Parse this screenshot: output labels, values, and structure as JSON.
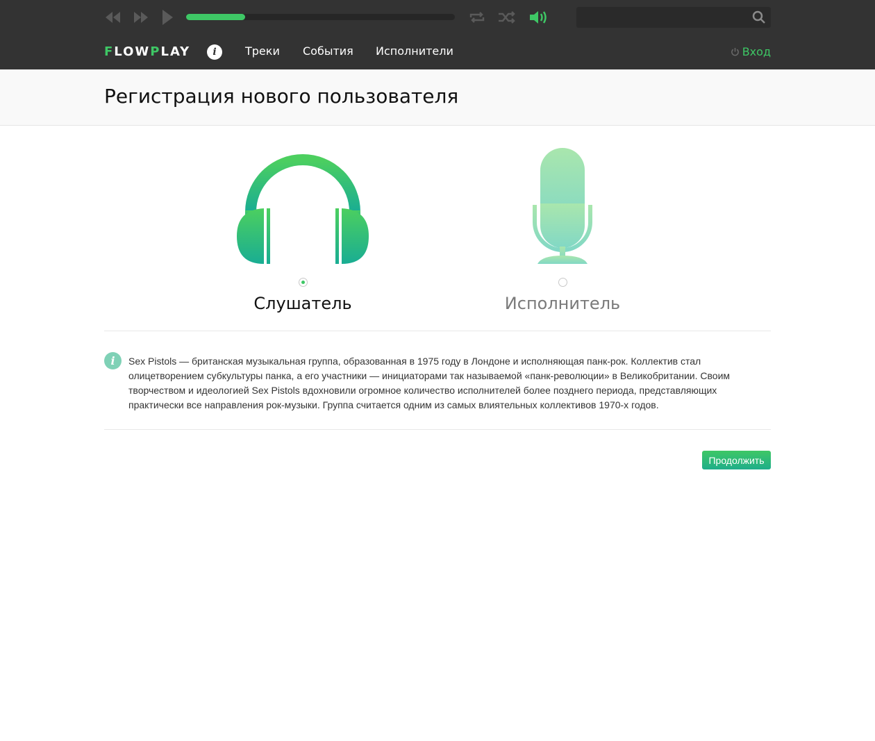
{
  "player": {
    "progress_fraction": 0.22,
    "search_placeholder": "",
    "accent_color": "#3ec765",
    "icons": [
      "rewind-icon",
      "fast-forward-icon",
      "play-icon",
      "repeat-icon",
      "shuffle-icon",
      "volume-icon",
      "search-icon"
    ]
  },
  "nav": {
    "logo_parts": [
      "F",
      "LOW",
      "P",
      "LAY"
    ],
    "info_glyph": "i",
    "links": [
      "Треки",
      "События",
      "Исполнители"
    ],
    "login": "Вход"
  },
  "page": {
    "title": "Регистрация нового пользователя"
  },
  "roles": {
    "listener": {
      "label": "Слушатель",
      "selected": true,
      "icon": "headphones-icon"
    },
    "artist": {
      "label": "Исполнитель",
      "selected": false,
      "icon": "microphone-icon"
    }
  },
  "info": {
    "glyph": "i",
    "text": "Sex Pistols  — британская музыкальная группа, образованная в 1975 году в Лондоне и исполняющая панк-рок. Коллектив стал олицетворением субкультуры панка, а его участники — инициаторами так называемой «панк-революции» в Великобритании. Своим творчеством и идеологией Sex Pistols вдохновили огромное количество исполнителей более позднего периода, представляющих практически все направления рок-музыки. Группа считается одним из самых влиятельных коллективов 1970-х годов."
  },
  "actions": {
    "continue_label": "Продолжить"
  }
}
